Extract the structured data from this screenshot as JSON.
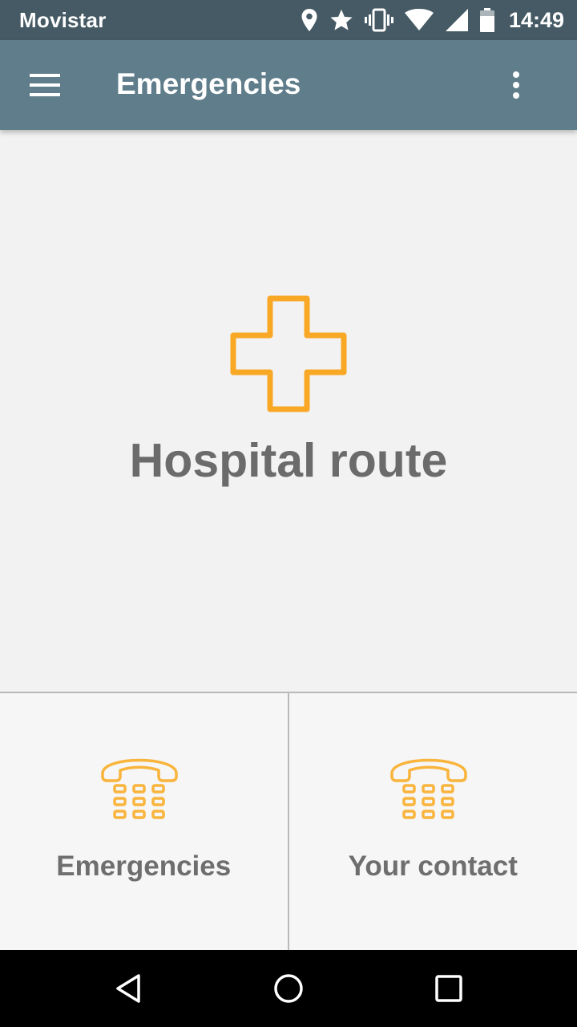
{
  "status_bar": {
    "carrier": "Movistar",
    "time": "14:49",
    "icons": [
      "location-icon",
      "star-icon",
      "vibrate-icon",
      "wifi-icon",
      "signal-icon",
      "battery-icon"
    ]
  },
  "app_bar": {
    "title": "Emergencies",
    "icons": [
      "menu-icon",
      "overflow-menu-icon"
    ]
  },
  "hospital_tile": {
    "label": "Hospital route",
    "icon": "hospital-cross-icon"
  },
  "tiles": [
    {
      "label": "Emergencies",
      "icon": "phone-icon"
    },
    {
      "label": "Your contact",
      "icon": "phone-icon"
    }
  ],
  "nav_bar": {
    "icons": [
      "back-icon",
      "home-icon",
      "recent-apps-icon"
    ]
  },
  "colors": {
    "status_bar": "#455a64",
    "app_bar": "#607d8b",
    "accent": "#f9a826",
    "label": "#6b6b6b"
  }
}
